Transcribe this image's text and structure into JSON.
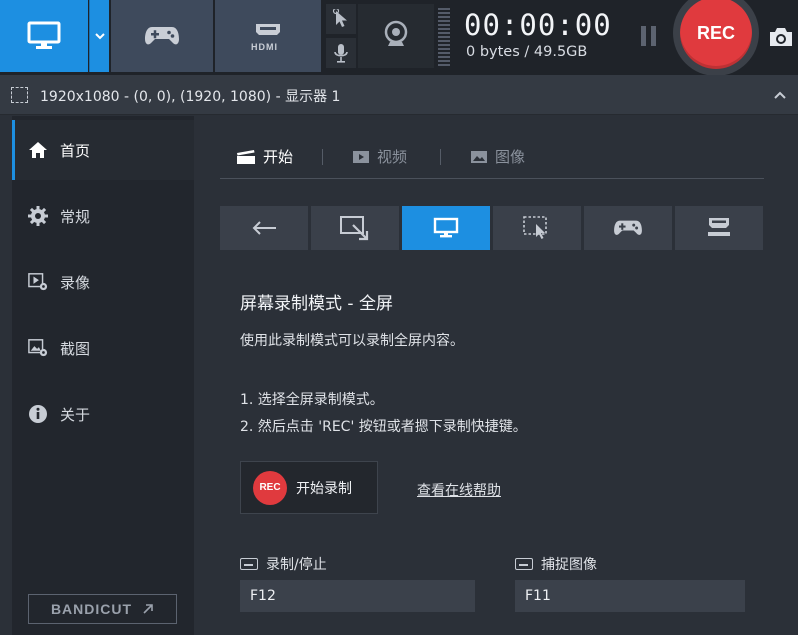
{
  "toolbar": {
    "timer": "00:00:00",
    "bytes": "0 bytes / 49.5GB",
    "rec_label": "REC",
    "hdmi_label": "HDMI",
    "icons": {
      "screen": "monitor-icon",
      "dropdown": "chevron-down-icon",
      "game": "gamepad-icon",
      "hdmi": "hdmi-icon",
      "cursor": "cursor-icon",
      "mic": "microphone-icon",
      "webcam": "webcam-icon",
      "pause": "pause-icon",
      "camera": "camera-icon"
    }
  },
  "resolution_bar": {
    "text": "1920x1080 - (0, 0), (1920, 1080) - 显示器 1"
  },
  "sidebar": {
    "items": [
      {
        "label": "首页",
        "icon": "home-icon",
        "active": true
      },
      {
        "label": "常规",
        "icon": "gear-icon",
        "active": false
      },
      {
        "label": "录像",
        "icon": "video-settings-icon",
        "active": false
      },
      {
        "label": "截图",
        "icon": "image-settings-icon",
        "active": false
      },
      {
        "label": "关于",
        "icon": "info-icon",
        "active": false
      }
    ],
    "bandicut_label": "BANDICUT"
  },
  "tabs": [
    {
      "label": "开始",
      "active": true
    },
    {
      "label": "视频",
      "active": false
    },
    {
      "label": "图像",
      "active": false
    }
  ],
  "mode_buttons": [
    {
      "icon": "back-arrow-icon"
    },
    {
      "icon": "region-select-icon"
    },
    {
      "icon": "fullscreen-monitor-icon",
      "active": true
    },
    {
      "icon": "cursor-area-icon"
    },
    {
      "icon": "gamepad-icon"
    },
    {
      "icon": "hdmi-icon"
    }
  ],
  "content": {
    "title": "屏幕录制模式 - 全屏",
    "description": "使用此录制模式可以录制全屏内容。",
    "step1": "1. 选择全屏录制模式。",
    "step2": "2. 然后点击 'REC' 按钮或者摁下录制快捷键。",
    "start_button_badge": "REC",
    "start_button_label": "开始录制",
    "help_link": "查看在线帮助"
  },
  "hotkeys": {
    "record_label": "录制/停止",
    "record_value": "F12",
    "capture_label": "捕捉图像",
    "capture_value": "F11"
  },
  "colors": {
    "accent": "#1d8fe1",
    "rec": "#e03a3e"
  }
}
